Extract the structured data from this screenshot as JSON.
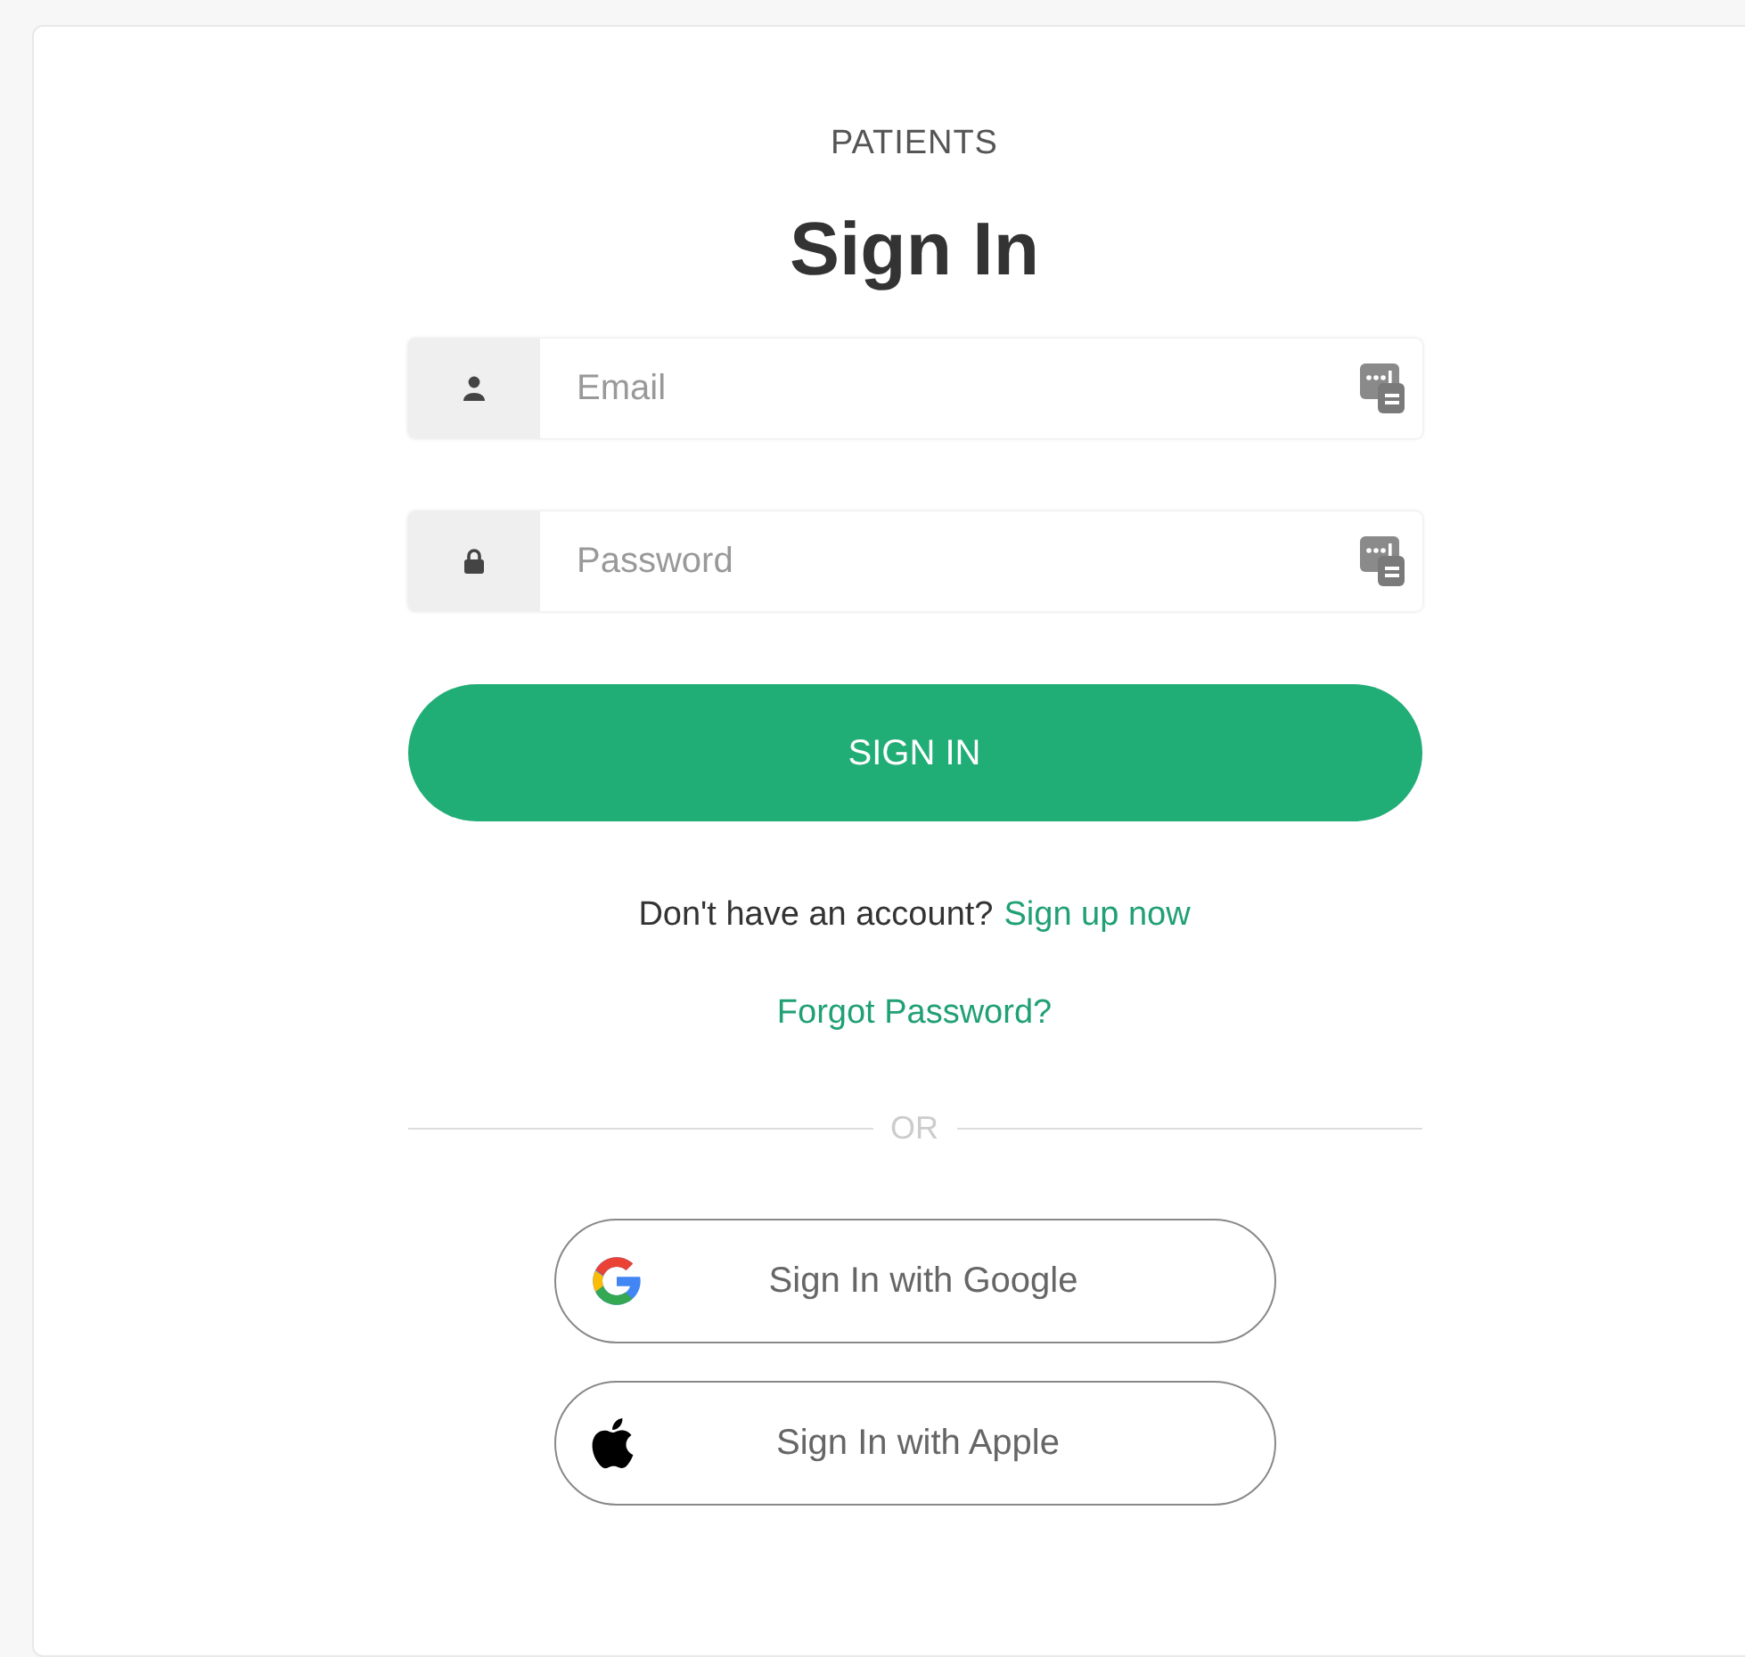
{
  "eyebrow": "PATIENTS",
  "title": "Sign In",
  "fields": [
    {
      "kind": "email",
      "placeholder": "Email"
    },
    {
      "kind": "password",
      "placeholder": "Password"
    }
  ],
  "submit_button": "SIGN IN",
  "signup_prompt": {
    "text": "Don't have an account?",
    "link": "Sign up now"
  },
  "forgot_link": "Forgot Password?",
  "divider": "OR",
  "social_buttons": [
    {
      "kind": "google",
      "label": "Sign In with Google"
    },
    {
      "kind": "apple",
      "label": "Sign In with Apple"
    }
  ]
}
